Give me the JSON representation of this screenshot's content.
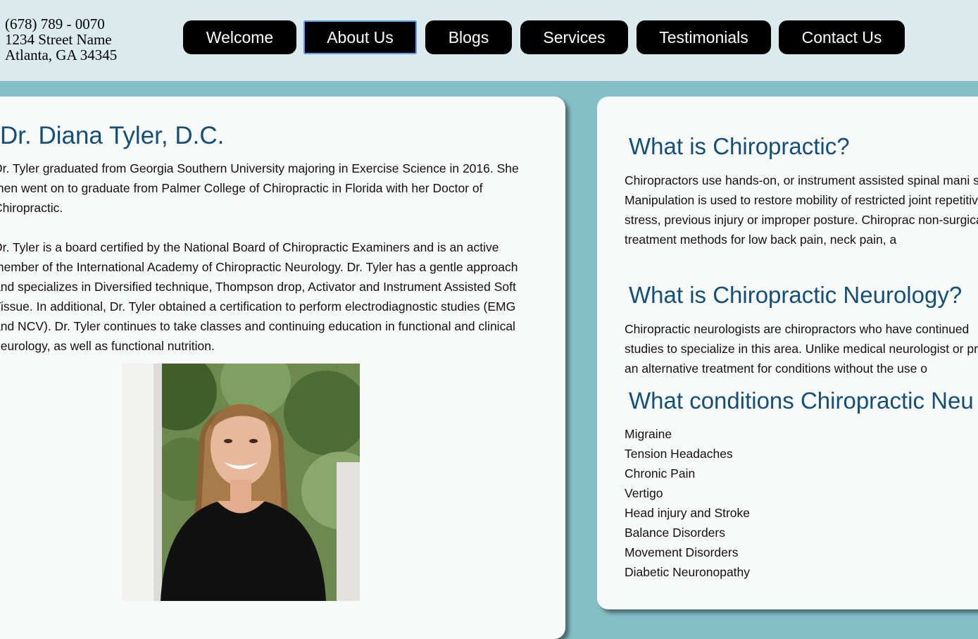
{
  "header": {
    "address_lines": [
      "(678) 789 - 0070",
      "1234 Street Name",
      "Atlanta, GA 34345"
    ]
  },
  "nav": {
    "items": [
      {
        "label": "Welcome"
      },
      {
        "label": "About Us"
      },
      {
        "label": "Blogs"
      },
      {
        "label": "Services"
      },
      {
        "label": "Testimonials"
      },
      {
        "label": "Contact Us"
      }
    ],
    "active": "About Us"
  },
  "doctor": {
    "name": "Dr. Diana Tyler, D.C.",
    "bio_1": "Dr. Tyler graduated from Georgia Southern University majoring in Exercise Science in 2016. She then went on to graduate from Palmer College of Chiropractic in Florida with her Doctor of Chiropractic.",
    "bio_2": "Dr. Tyler is a board certified by the National Board of Chiropractic Examiners and is an active member of the International Academy of Chiropractic Neurology. Dr. Tyler has a gentle approach and specializes in Diversified technique, Thompson drop, Activator and Instrument Assisted Soft Tissue. In additional, Dr. Tyler obtained a certification to perform electrodiagnostic studies (EMG and NCV). Dr. Tyler continues to take classes and continuing education in functional and clinical neurology, as well as functional nutrition."
  },
  "info": {
    "chiro_title": "What is Chiropractic?",
    "chiro_text": "Chiropractors use hands-on, or instrument assisted spinal mani spine. Manipulation is used to restore mobility of restricted joint repetitive stress, previous injury or improper posture. Chiroprac non-surgical treatment methods for low back pain, neck pain, a",
    "neuro_title": "What is Chiropractic Neurology?",
    "neuro_text": "Chiropractic neurologists are chiropractors who have continued studies to specialize in this area. Unlike medical neurologist or provide an alternative treatment for conditions without the use o",
    "conditions_title": "What conditions Chiropractic Neu",
    "conditions": [
      "Migraine",
      "Tension Headaches",
      "Chronic Pain",
      "Vertigo",
      "Head injury and Stroke",
      "Balance Disorders",
      "Movement Disorders",
      "Diabetic Neuronopathy"
    ]
  },
  "colors": {
    "page_bg": "#84bfc8",
    "header_bg": "#daeaed",
    "heading": "#134f79",
    "nav_bg": "#000000",
    "active_outline": "#5a9df0"
  }
}
